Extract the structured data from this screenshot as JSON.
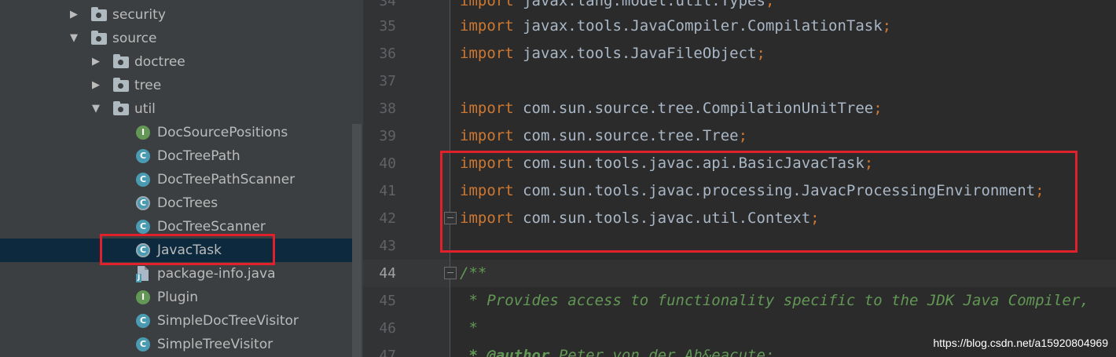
{
  "project_tree": {
    "items": [
      {
        "label": "security",
        "type": "folder",
        "expanded": false
      },
      {
        "label": "source",
        "type": "folder",
        "expanded": true
      },
      {
        "label": "doctree",
        "type": "folder",
        "expanded": false
      },
      {
        "label": "tree",
        "type": "folder",
        "expanded": false
      },
      {
        "label": "util",
        "type": "folder",
        "expanded": true
      },
      {
        "label": "DocSourcePositions",
        "type": "interface",
        "icon_letter": "I"
      },
      {
        "label": "DocTreePath",
        "type": "class",
        "icon_letter": "C"
      },
      {
        "label": "DocTreePathScanner",
        "type": "class",
        "icon_letter": "C"
      },
      {
        "label": "DocTrees",
        "type": "abstract-class",
        "icon_letter": "C"
      },
      {
        "label": "DocTreeScanner",
        "type": "class",
        "icon_letter": "C"
      },
      {
        "label": "JavacTask",
        "type": "abstract-class",
        "icon_letter": "C",
        "selected": true
      },
      {
        "label": "package-info.java",
        "type": "java-file",
        "icon_letter": "J"
      },
      {
        "label": "Plugin",
        "type": "interface",
        "icon_letter": "I"
      },
      {
        "label": "SimpleDocTreeVisitor",
        "type": "class",
        "icon_letter": "C"
      },
      {
        "label": "SimpleTreeVisitor",
        "type": "class",
        "icon_letter": "C"
      }
    ]
  },
  "editor": {
    "current_line": "44",
    "lines": [
      {
        "num": "34",
        "kw": "import",
        "rest": " javax.lang.model.util.Types",
        "semi": ";"
      },
      {
        "num": "35",
        "kw": "import",
        "rest": " javax.tools.JavaCompiler.CompilationTask",
        "semi": ";"
      },
      {
        "num": "36",
        "kw": "import",
        "rest": " javax.tools.JavaFileObject",
        "semi": ";"
      },
      {
        "num": "37",
        "kw": "",
        "rest": "",
        "semi": ""
      },
      {
        "num": "38",
        "kw": "import",
        "rest": " com.sun.source.tree.CompilationUnitTree",
        "semi": ";"
      },
      {
        "num": "39",
        "kw": "import",
        "rest": " com.sun.source.tree.Tree",
        "semi": ";"
      },
      {
        "num": "40",
        "kw": "import",
        "rest": " com.sun.tools.javac.api.BasicJavacTask",
        "semi": ";"
      },
      {
        "num": "41",
        "kw": "import",
        "rest": " com.sun.tools.javac.processing.JavacProcessingEnvironment",
        "semi": ";"
      },
      {
        "num": "42",
        "kw": "import",
        "rest": " com.sun.tools.javac.util.Context",
        "semi": ";"
      },
      {
        "num": "43",
        "kw": "",
        "rest": "",
        "semi": ""
      },
      {
        "num": "44",
        "comment": "/**"
      },
      {
        "num": "45",
        "comment": " * Provides access to functionality specific to the JDK Java Compiler,"
      },
      {
        "num": "46",
        "comment": " *"
      },
      {
        "num": "47",
        "comment_tag": " * @author",
        "comment": " Peter von der Ah&eacute;"
      }
    ]
  },
  "watermark": "https://blog.csdn.net/a15920804969",
  "colors": {
    "highlight_box": "#e0202a",
    "keyword": "#cc7832",
    "comment": "#629755",
    "selection": "#0d293e"
  }
}
